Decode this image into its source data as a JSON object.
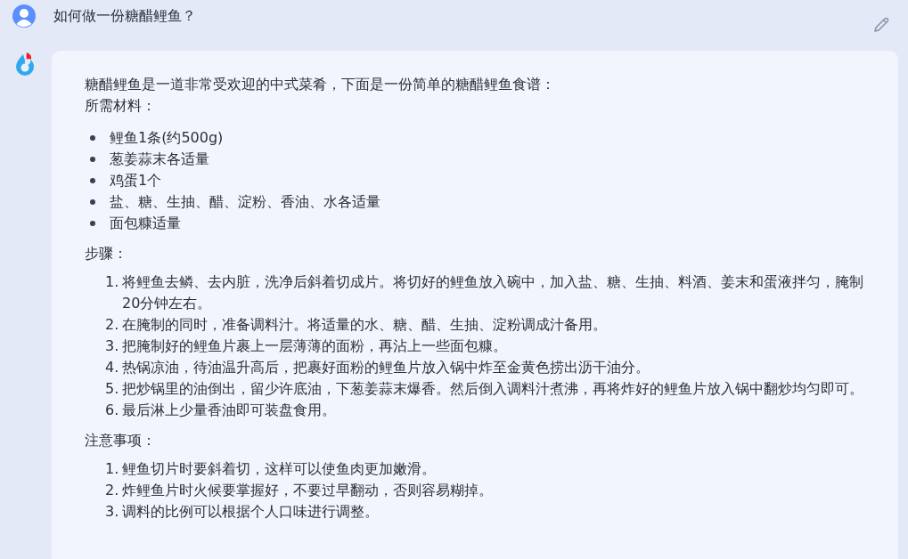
{
  "question": {
    "text": "如何做一份糖醋鲤鱼？"
  },
  "answer": {
    "intro": "糖醋鲤鱼是一道非常受欢迎的中式菜肴，下面是一份简单的糖醋鲤鱼食谱：",
    "ingredients_heading": "所需材料：",
    "ingredients": [
      "鲤鱼1条(约500g)",
      "葱姜蒜末各适量",
      "鸡蛋1个",
      "盐、糖、生抽、醋、淀粉、香油、水各适量",
      "面包糠适量"
    ],
    "steps_heading": "步骤：",
    "steps": [
      {
        "number": "1.",
        "text": "将鲤鱼去鳞、去内脏，洗净后斜着切成片。将切好的鲤鱼放入碗中，加入盐、糖、生抽、料酒、姜末和蛋液拌匀，腌制20分钟左右。"
      },
      {
        "number": "2.",
        "text": "在腌制的同时，准备调料汁。将适量的水、糖、醋、生抽、淀粉调成汁备用。"
      },
      {
        "number": "3.",
        "text": "把腌制好的鲤鱼片裹上一层薄薄的面粉，再沾上一些面包糠。"
      },
      {
        "number": "4.",
        "text": "热锅凉油，待油温升高后，把裹好面粉的鲤鱼片放入锅中炸至金黄色捞出沥干油分。"
      },
      {
        "number": "5.",
        "text": "把炒锅里的油倒出，留少许底油，下葱姜蒜末爆香。然后倒入调料汁煮沸，再将炸好的鲤鱼片放入锅中翻炒均匀即可。"
      },
      {
        "number": "6.",
        "text": "最后淋上少量香油即可装盘食用。"
      }
    ],
    "notes_heading": "注意事项：",
    "notes": [
      {
        "number": "1.",
        "text": "鲤鱼切片时要斜着切，这样可以使鱼肉更加嫩滑。"
      },
      {
        "number": "2.",
        "text": "炸鲤鱼片时火候要掌握好，不要过早翻动，否则容易糊掉。"
      },
      {
        "number": "3.",
        "text": "调料的比例可以根据个人口味进行调整。"
      }
    ]
  }
}
